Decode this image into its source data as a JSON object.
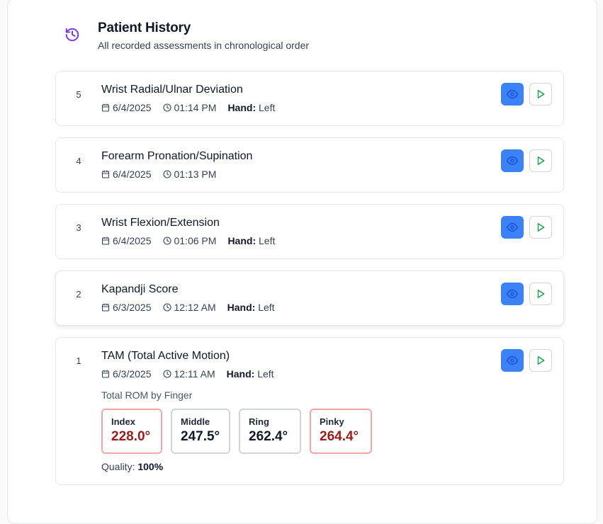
{
  "header": {
    "title": "Patient History",
    "subtitle": "All recorded assessments in chronological order",
    "icon": "history-icon"
  },
  "colors": {
    "accent_purple": "#7c3aed",
    "view_button": "#3b82f6",
    "play_icon": "#16a34a",
    "warning_border": "#f2a5a5",
    "warning_text": "#9b1c1c"
  },
  "assessments": [
    {
      "number": "5",
      "title": "Wrist Radial/Ulnar Deviation",
      "date": "6/4/2025",
      "time": "01:14 PM",
      "hand_label": "Hand:",
      "hand": "Left"
    },
    {
      "number": "4",
      "title": "Forearm Pronation/Supination",
      "date": "6/4/2025",
      "time": "01:13 PM",
      "hand_label": "",
      "hand": ""
    },
    {
      "number": "3",
      "title": "Wrist Flexion/Extension",
      "date": "6/4/2025",
      "time": "01:06 PM",
      "hand_label": "Hand:",
      "hand": "Left"
    },
    {
      "number": "2",
      "title": "Kapandji Score",
      "date": "6/3/2025",
      "time": "12:12 AM",
      "hand_label": "Hand:",
      "hand": "Left"
    },
    {
      "number": "1",
      "title": "TAM (Total Active Motion)",
      "date": "6/3/2025",
      "time": "12:11 AM",
      "hand_label": "Hand:",
      "hand": "Left",
      "rom_label": "Total ROM by Finger",
      "fingers": [
        {
          "name": "Index",
          "value": "228.0°",
          "flagged": true
        },
        {
          "name": "Middle",
          "value": "247.5°",
          "flagged": false
        },
        {
          "name": "Ring",
          "value": "262.4°",
          "flagged": false
        },
        {
          "name": "Pinky",
          "value": "264.4°",
          "flagged": true
        }
      ],
      "quality_label": "Quality:",
      "quality_value": "100%"
    }
  ]
}
